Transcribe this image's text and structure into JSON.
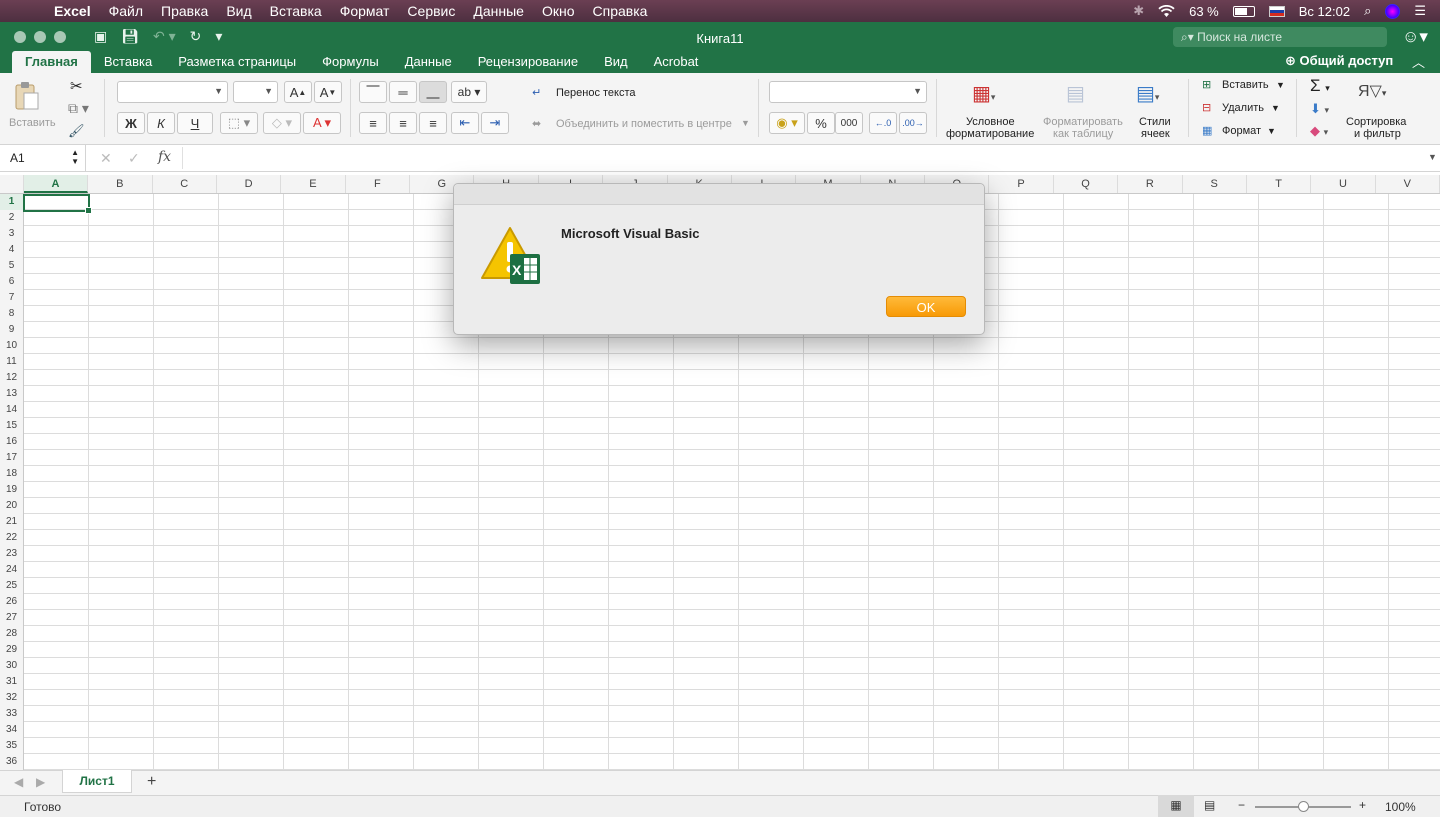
{
  "menubar": {
    "app": "Excel",
    "items": [
      "Файл",
      "Правка",
      "Вид",
      "Вставка",
      "Формат",
      "Сервис",
      "Данные",
      "Окно",
      "Справка"
    ],
    "battery": "63 %",
    "clock": "Вс 12:02"
  },
  "window": {
    "title": "Книга11",
    "search_placeholder": "Поиск на листе",
    "share": "Общий доступ"
  },
  "tabs": [
    "Главная",
    "Вставка",
    "Разметка страницы",
    "Формулы",
    "Данные",
    "Рецензирование",
    "Вид",
    "Acrobat"
  ],
  "ribbon": {
    "paste": "Вставить",
    "bold": "Ж",
    "italic": "К",
    "underline": "Ч",
    "wrap": "Перенос текста",
    "merge": "Объединить и поместить в центре",
    "conditional": [
      "Условное",
      "форматирование"
    ],
    "format_table": [
      "Форматировать",
      "как таблицу"
    ],
    "styles": [
      "Стили",
      "ячеек"
    ],
    "insert": "Вставить",
    "delete": "Удалить",
    "format": "Формат",
    "sort": [
      "Сортировка",
      "и фильтр"
    ],
    "percent": "%",
    "thousands": "000"
  },
  "formula_bar": {
    "name_box": "A1",
    "fx": "fx"
  },
  "columns": [
    "A",
    "B",
    "C",
    "D",
    "E",
    "F",
    "G",
    "H",
    "I",
    "J",
    "K",
    "L",
    "M",
    "N",
    "O",
    "P",
    "Q",
    "R",
    "S",
    "T",
    "U",
    "V"
  ],
  "rows_count": 36,
  "sheet": {
    "tab": "Лист1",
    "add": "+"
  },
  "status": {
    "ready": "Готово",
    "zoom": "100%"
  },
  "dialog": {
    "title": "Microsoft Visual Basic",
    "ok": "OK"
  },
  "colors": {
    "excel_green": "#217346",
    "ok_orange": "#f89a06"
  }
}
